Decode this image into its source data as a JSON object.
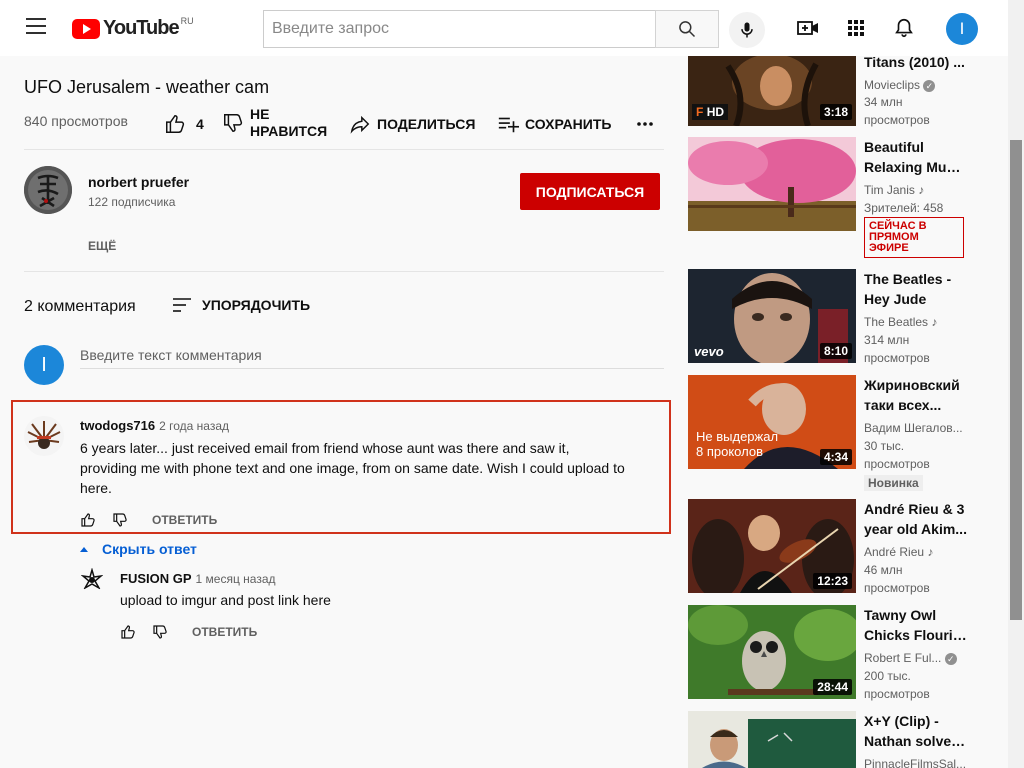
{
  "masthead": {
    "logo_text": "YouTube",
    "region": "RU",
    "search_placeholder": "Введите запрос",
    "avatar_letter": "I"
  },
  "video": {
    "title": "UFO Jerusalem - weather cam",
    "views": "840 просмотров",
    "like_count": "4",
    "dislike_label_line1": "НЕ",
    "dislike_label_line2": "НРАВИТСЯ",
    "share_label": "ПОДЕЛИТЬСЯ",
    "save_label": "СОХРАНИТЬ"
  },
  "channel": {
    "name": "norbert pruefer",
    "subscribers": "122 подписчика",
    "subscribe_label": "ПОДПИСАТЬСЯ",
    "more_label": "ЕЩЁ"
  },
  "comments": {
    "count_label": "2 комментария",
    "sort_label": "УПОРЯДОЧИТЬ",
    "input_placeholder": "Введите текст комментария",
    "user_avatar_letter": "I",
    "hide_replies_label": "Скрыть ответ",
    "items": [
      {
        "author": "twodogs716",
        "time": "2 года назад",
        "text_lines": [
          "6 years later... just received email from friend whose aunt was there and saw it,",
          "providing me with phone text and one image, from on same date. Wish I could upload to",
          "here."
        ],
        "reply_label": "ОТВЕТИТЬ"
      },
      {
        "author": "FUSION GP",
        "time": "1 месяц назад",
        "text_lines": [
          "upload to imgur and post link here"
        ],
        "reply_label": "ОТВЕТИТЬ"
      }
    ]
  },
  "recommendations": [
    {
      "title1": "Titans (2010) ...",
      "title2": "",
      "channel": "Movieclips",
      "meta": "34 млн",
      "meta2": "просмотров",
      "duration": "3:18",
      "hd_label": "HD"
    },
    {
      "title1": "Beautiful",
      "title2": "Relaxing Musi...",
      "channel": "Tim Janis",
      "meta": "Зрителей: 458",
      "meta2": "",
      "live_badge": "СЕЙЧАС В ПРЯМОМ ЭФИРЕ"
    },
    {
      "title1": "The Beatles -",
      "title2": "Hey Jude",
      "channel": "The Beatles",
      "meta": "314 млн",
      "meta2": "просмотров",
      "duration": "8:10",
      "watermark": "vevo"
    },
    {
      "title1": "Жириновский",
      "title2": "таки всех...",
      "channel": "Вадим Шегалов...",
      "meta": "30 тыс.",
      "meta2": "просмотров",
      "duration": "4:34",
      "overlay1": "Не выдержал",
      "overlay2": "8 проколов",
      "new_badge": "Новинка"
    },
    {
      "title1": "André Rieu & 3",
      "title2": "year old Akim...",
      "channel": "André Rieu",
      "meta": "46 млн",
      "meta2": "просмотров",
      "duration": "12:23"
    },
    {
      "title1": "Tawny Owl",
      "title2": "Chicks Flouris...",
      "channel": "Robert E Ful...",
      "meta": "200 тыс.",
      "meta2": "просмотров",
      "duration": "28:44"
    },
    {
      "title1": "X+Y (Clip) -",
      "title2": "Nathan solves...",
      "channel": "PinnacleFilmsSal...",
      "meta": "",
      "meta2": ""
    }
  ],
  "colors": {
    "brand_red": "#ff0000",
    "subscribe_red": "#cc0000",
    "link_blue": "#065fd4",
    "avatar_blue": "#1c87d9",
    "highlight_border": "#d0321b"
  }
}
